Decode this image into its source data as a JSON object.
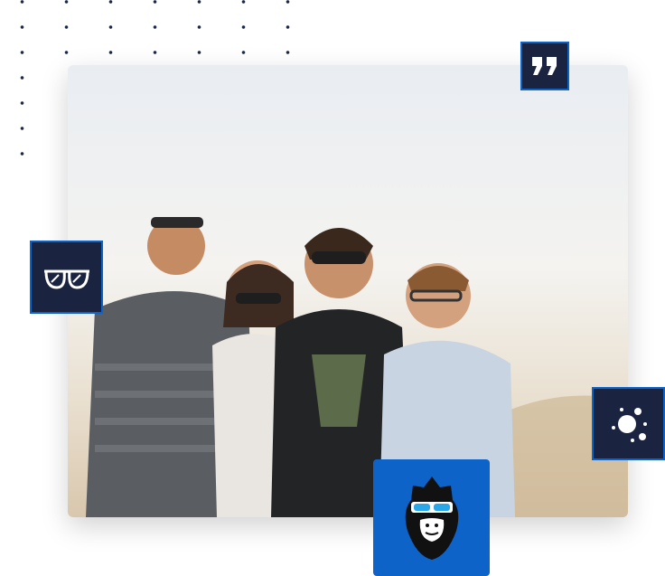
{
  "icons": {
    "quote": "quote-icon",
    "glasses": "sunglasses-icon",
    "planet": "planet-icon",
    "mascot": "monkey-mascot-icon"
  },
  "colors": {
    "navy": "#1a2440",
    "blue": "#0d63c8",
    "dots": "#1b2a4a"
  }
}
